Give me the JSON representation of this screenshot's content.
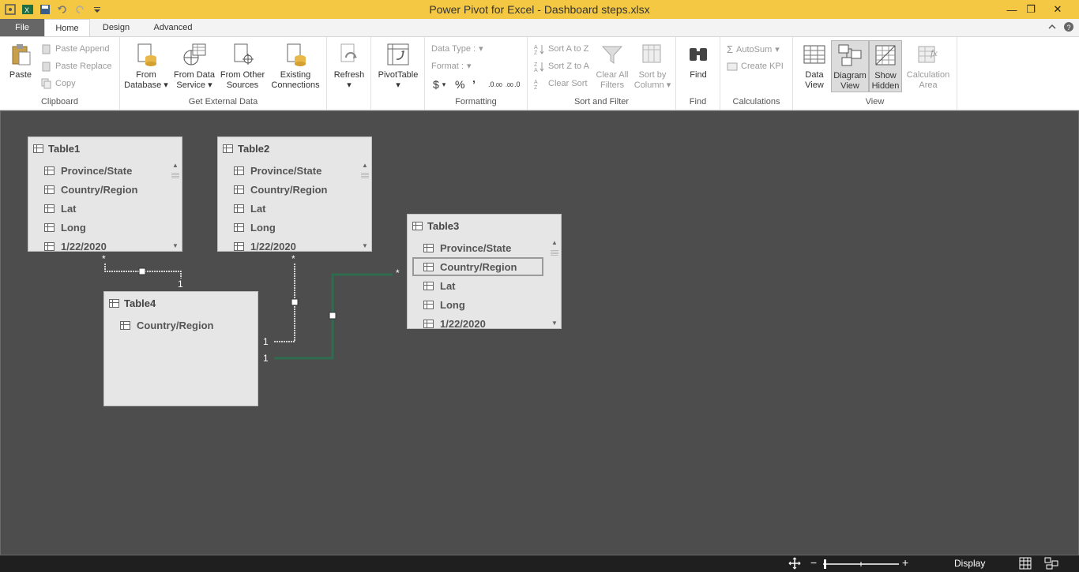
{
  "window": {
    "title": "Power Pivot for Excel - Dashboard steps.xlsx",
    "controls": {
      "minimize": "—",
      "restore": "❐",
      "close": "✕"
    }
  },
  "tabs": {
    "file": "File",
    "home": "Home",
    "design": "Design",
    "advanced": "Advanced"
  },
  "ribbon": {
    "clipboard": {
      "label": "Clipboard",
      "paste": "Paste",
      "paste_append": "Paste Append",
      "paste_replace": "Paste Replace",
      "copy": "Copy"
    },
    "external": {
      "label": "Get External Data",
      "from_database": [
        "From",
        "Database"
      ],
      "from_data_service": [
        "From Data",
        "Service"
      ],
      "from_other_sources": [
        "From Other",
        "Sources"
      ],
      "existing_connections": [
        "Existing",
        "Connections"
      ]
    },
    "refresh": "Refresh",
    "pivottable": "PivotTable",
    "formatting": {
      "label": "Formatting",
      "data_type": "Data Type :",
      "format": "Format :",
      "dollar": "$",
      "percent": "%",
      "comma": "ʼ"
    },
    "sort_filter": {
      "label": "Sort and Filter",
      "sort_az": "Sort A to Z",
      "sort_za": "Sort Z to A",
      "clear_sort": "Clear Sort",
      "clear_all_filters": [
        "Clear All",
        "Filters"
      ],
      "sort_by_column": [
        "Sort by",
        "Column"
      ]
    },
    "find": {
      "label": "Find",
      "find": "Find"
    },
    "calculations": {
      "label": "Calculations",
      "autosum": "AutoSum",
      "create_kpi": "Create KPI"
    },
    "view": {
      "label": "View",
      "data_view": [
        "Data",
        "View"
      ],
      "diagram_view": [
        "Diagram",
        "View"
      ],
      "show_hidden": [
        "Show",
        "Hidden"
      ],
      "calculation_area": [
        "Calculation",
        "Area"
      ]
    }
  },
  "diagram": {
    "tables": [
      {
        "name": "Table1",
        "columns": [
          "Province/State",
          "Country/Region",
          "Lat",
          "Long",
          "1/22/2020"
        ]
      },
      {
        "name": "Table2",
        "columns": [
          "Province/State",
          "Country/Region",
          "Lat",
          "Long",
          "1/22/2020"
        ]
      },
      {
        "name": "Table3",
        "columns": [
          "Province/State",
          "Country/Region",
          "Lat",
          "Long",
          "1/22/2020"
        ],
        "selected_column": "Country/Region"
      },
      {
        "name": "Table4",
        "columns": [
          "Country/Region"
        ]
      }
    ],
    "relationships": [
      {
        "from": "Table1",
        "to": "Table4",
        "from_card": "*",
        "to_card": "1",
        "active": false
      },
      {
        "from": "Table2",
        "to": "Table4",
        "from_card": "*",
        "to_card": "1",
        "active": false
      },
      {
        "from": "Table3",
        "to": "Table4",
        "from_card": "*",
        "to_card": "1",
        "active": true
      }
    ],
    "colors": {
      "canvas": "#4d4d4d",
      "active_relationship": "#2e6b4f",
      "inactive_relationship": "#ffffff"
    }
  },
  "statusbar": {
    "display": "Display"
  }
}
